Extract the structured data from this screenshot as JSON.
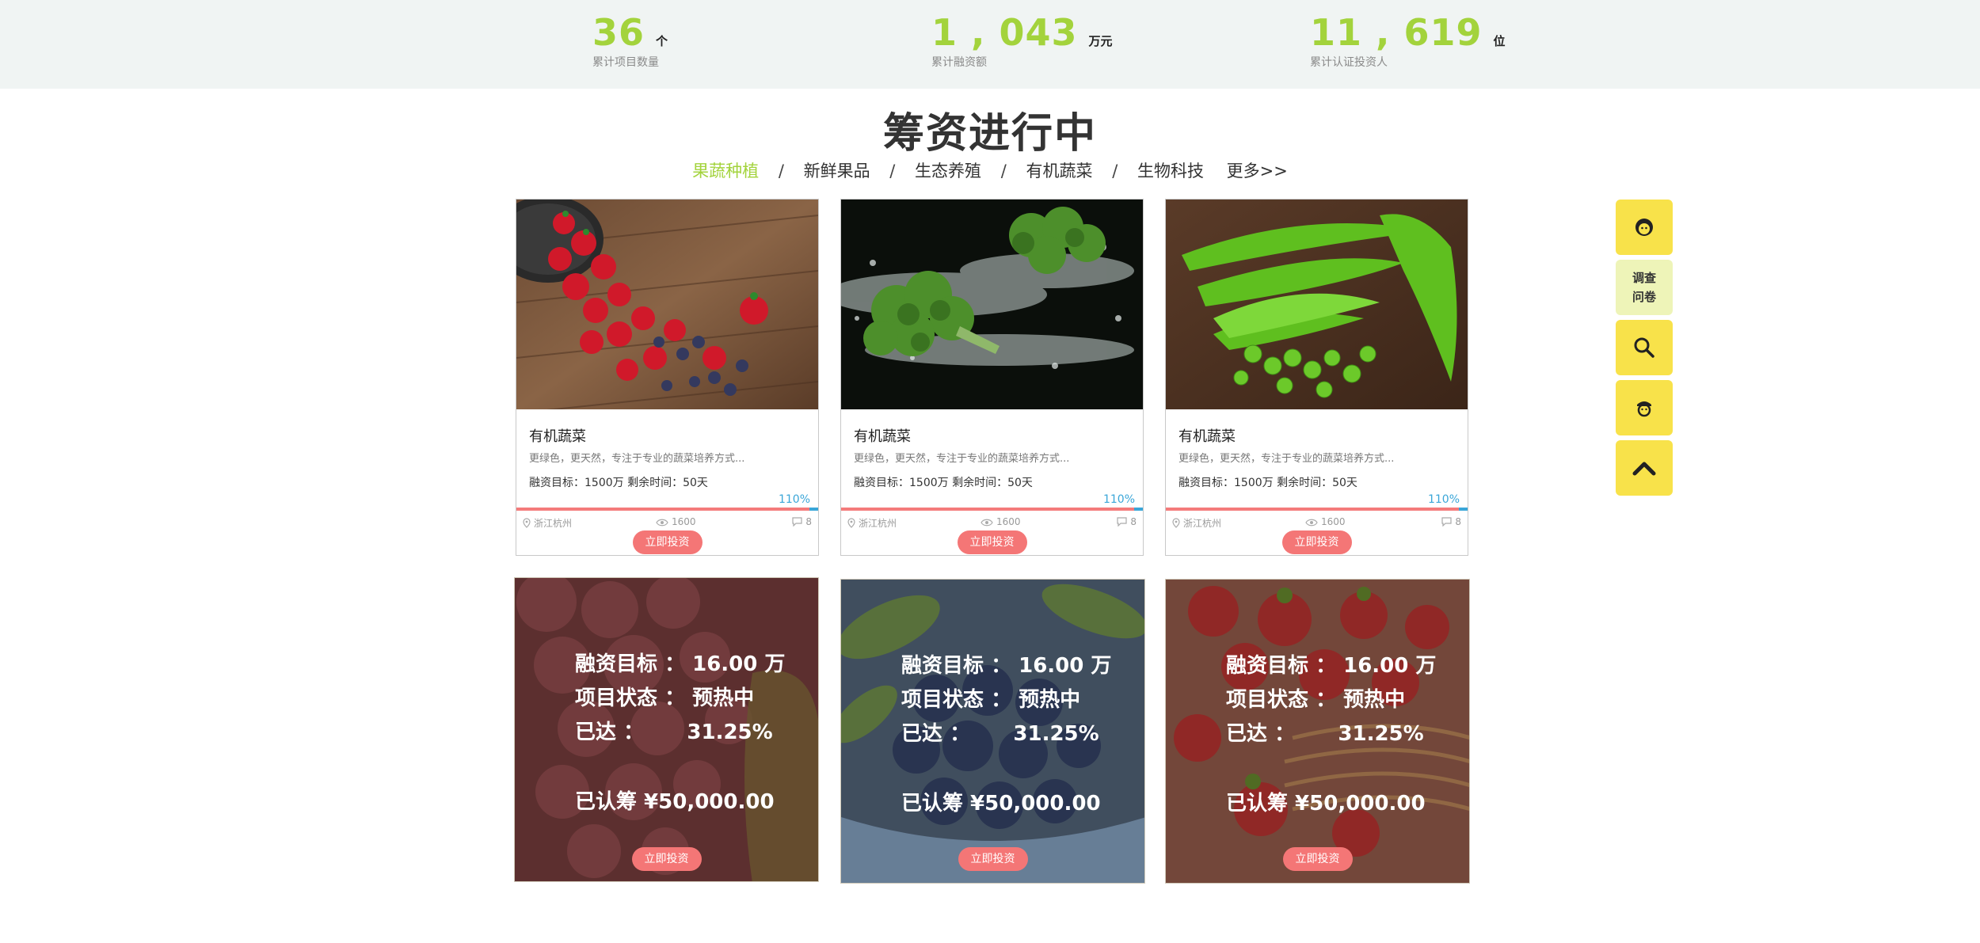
{
  "stats": [
    {
      "number": "36",
      "unit": "个",
      "label": "累计项目数量"
    },
    {
      "number": "1 , 043",
      "unit": "万元",
      "label": "累计融资额"
    },
    {
      "number": "11 , 619",
      "unit": "位",
      "label": "累计认证投资人"
    }
  ],
  "section": {
    "title": "筹资进行中",
    "categories": [
      "果蔬种植",
      "新鲜果品",
      "生态养殖",
      "有机蔬菜",
      "生物科技"
    ],
    "separator": "/",
    "more": "更多>>"
  },
  "cards": [
    {
      "title": "有机蔬菜",
      "desc": "更绿色，更天然，专注于专业的蔬菜培养方式...",
      "meta": "融资目标：1500万  剩余时间：50天",
      "percent": "110%",
      "progress": 0.97,
      "location": "浙江杭州",
      "views": "1600",
      "comments": "8",
      "button": "立即投资",
      "photo": "strawberries-icon"
    },
    {
      "title": "有机蔬菜",
      "desc": "更绿色，更天然，专注于专业的蔬菜培养方式...",
      "meta": "融资目标：1500万  剩余时间：50天",
      "percent": "110%",
      "progress": 0.97,
      "location": "浙江杭州",
      "views": "1600",
      "comments": "8",
      "button": "立即投资",
      "photo": "broccoli-icon"
    },
    {
      "title": "有机蔬菜",
      "desc": "更绿色，更天然，专注于专业的蔬菜培养方式...",
      "meta": "融资目标：1500万  剩余时间：50天",
      "percent": "110%",
      "progress": 0.97,
      "location": "浙江杭州",
      "views": "1600",
      "comments": "8",
      "button": "立即投资",
      "photo": "peas-icon"
    }
  ],
  "overlay_cards": [
    {
      "target_label": "融资目标",
      "target_value": "16.00 万",
      "status_label": "项目状态",
      "status_value": "预热中",
      "reached_label": "已达",
      "reached_value": "31.25%",
      "raised": "已认筹 ¥50,000.00",
      "button": "立即投资",
      "photo": "grapes-icon"
    },
    {
      "target_label": "融资目标",
      "target_value": "16.00 万",
      "status_label": "项目状态",
      "status_value": "预热中",
      "reached_label": "已达",
      "reached_value": "31.25%",
      "raised": "已认筹 ¥50,000.00",
      "button": "立即投资",
      "photo": "blueberries-icon"
    },
    {
      "target_label": "融资目标",
      "target_value": "16.00 万",
      "status_label": "项目状态",
      "status_value": "预热中",
      "reached_label": "已达",
      "reached_value": "31.25%",
      "raised": "已认筹 ¥50,000.00",
      "button": "立即投资",
      "photo": "strawberry-basket-icon"
    }
  ],
  "sidebar": {
    "survey_line1": "调查",
    "survey_line2": "问卷",
    "icons": [
      "customer-service-icon",
      "survey",
      "search-icon",
      "agent-icon",
      "back-to-top-icon"
    ]
  },
  "colors": {
    "accent_green": "#a3d33c",
    "progress_red": "#f47b7b",
    "progress_blue": "#3aa6d8",
    "button_red": "#f47676",
    "sidebar_yellow": "#f8e24a"
  }
}
